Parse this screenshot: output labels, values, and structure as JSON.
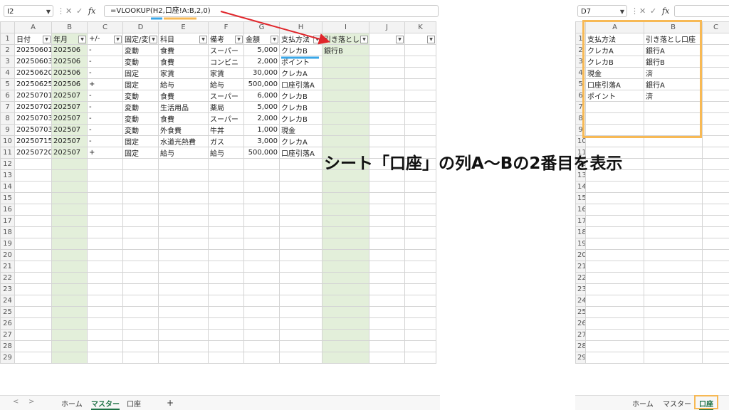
{
  "left": {
    "name_box": "I2",
    "formula": "=VLOOKUP(H2,口座!A:B,2,0)",
    "columns": [
      "A",
      "B",
      "C",
      "D",
      "E",
      "F",
      "G",
      "H",
      "I",
      "J",
      "K"
    ],
    "headers": [
      "日付",
      "年月",
      "+/-",
      "固定/変動",
      "科目",
      "備考",
      "金額",
      "支払方法",
      "引き落とし"
    ],
    "rows": [
      [
        "20250601",
        "202506",
        "-",
        "変動",
        "食費",
        "スーパー",
        "5,000",
        "クレカB",
        "銀行B"
      ],
      [
        "20250603",
        "202506",
        "-",
        "変動",
        "食費",
        "コンビニ",
        "2,000",
        "ポイント",
        ""
      ],
      [
        "20250620",
        "202506",
        "-",
        "固定",
        "家賃",
        "家賃",
        "30,000",
        "クレカA",
        ""
      ],
      [
        "20250625",
        "202506",
        "+",
        "固定",
        "給与",
        "給与",
        "500,000",
        "口座引落A",
        ""
      ],
      [
        "20250701",
        "202507",
        "-",
        "変動",
        "食費",
        "スーパー",
        "6,000",
        "クレカB",
        ""
      ],
      [
        "20250702",
        "202507",
        "-",
        "変動",
        "生活用品",
        "薬局",
        "5,000",
        "クレカB",
        ""
      ],
      [
        "20250703",
        "202507",
        "-",
        "変動",
        "食費",
        "スーパー",
        "2,000",
        "クレカB",
        ""
      ],
      [
        "20250703",
        "202507",
        "-",
        "変動",
        "外食費",
        "牛丼",
        "1,000",
        "現金",
        ""
      ],
      [
        "20250715",
        "202507",
        "-",
        "固定",
        "水道光熱費",
        "ガス",
        "3,000",
        "クレカA",
        ""
      ],
      [
        "20250720",
        "202507",
        "+",
        "固定",
        "給与",
        "給与",
        "500,000",
        "口座引落A",
        ""
      ]
    ],
    "row_numbers": [
      "1",
      "2",
      "3",
      "4",
      "5",
      "6",
      "7",
      "8",
      "9",
      "10",
      "11",
      "12",
      "13",
      "14",
      "15",
      "16",
      "17",
      "18",
      "19",
      "20",
      "21",
      "22",
      "23",
      "24",
      "25",
      "26",
      "27",
      "28",
      "29"
    ],
    "sheet_tabs": [
      "ホーム",
      "マスター",
      "口座"
    ],
    "active_tab": "マスター",
    "add_sheet": "+",
    "nav_prev": "<",
    "nav_next": ">"
  },
  "right": {
    "name_box": "D7",
    "columns": [
      "A",
      "B",
      "C"
    ],
    "rows": [
      [
        "支払方法",
        "引き落とし口座"
      ],
      [
        "クレカA",
        "銀行A"
      ],
      [
        "クレカB",
        "銀行B"
      ],
      [
        "現金",
        "済"
      ],
      [
        "口座引落A",
        "銀行A"
      ],
      [
        "ポイント",
        "済"
      ]
    ],
    "row_numbers": [
      "1",
      "2",
      "3",
      "4",
      "5",
      "6",
      "7",
      "8",
      "9",
      "10",
      "11",
      "12",
      "13",
      "14",
      "15",
      "16",
      "17",
      "18",
      "19",
      "20",
      "21",
      "22",
      "23",
      "24",
      "25",
      "26",
      "27",
      "28",
      "29"
    ],
    "sheet_tabs": [
      "ホーム",
      "マスター",
      "口座"
    ],
    "active_tab": "口座"
  },
  "callout": "シート「口座」の列A〜Bの2番目を表示",
  "colors": {
    "accent_orange": "#f7b955",
    "arrow_red": "#e0262b",
    "underline_blue": "#3aa7e8",
    "green_column": "#e3efda"
  },
  "icons": [
    "chevron-down-icon",
    "cancel-icon",
    "confirm-icon",
    "fx-icon",
    "filter-dropdown-icon"
  ]
}
